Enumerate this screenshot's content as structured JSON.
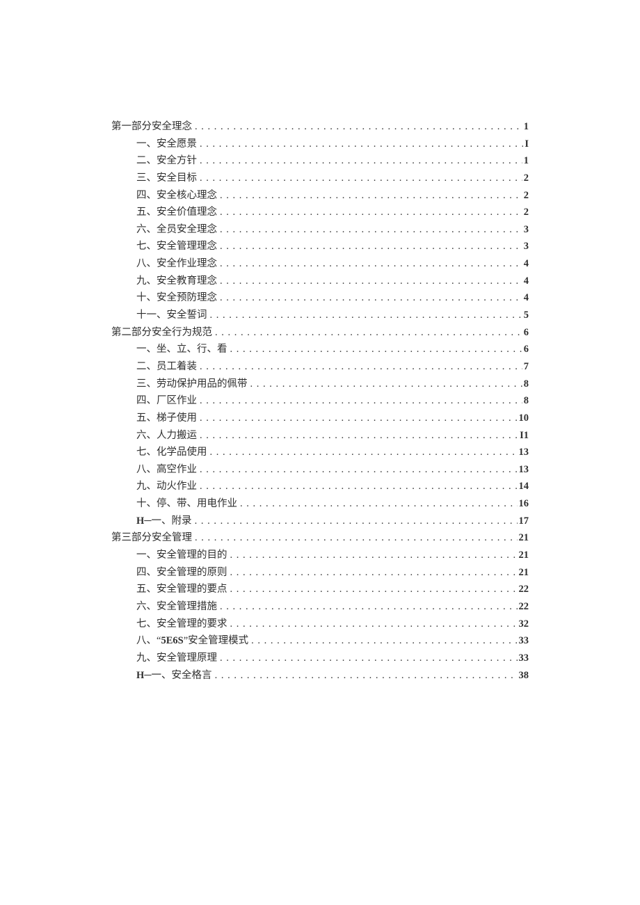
{
  "toc": [
    {
      "level": 0,
      "label": "第一部分安全理念",
      "page": "1"
    },
    {
      "level": 1,
      "label": "一、安全愿景",
      "page": "I"
    },
    {
      "level": 1,
      "label": "二、安全方针",
      "page": "1"
    },
    {
      "level": 1,
      "label": "三、安全目标",
      "page": "2"
    },
    {
      "level": 1,
      "label": "四、安全核心理念",
      "page": "2"
    },
    {
      "level": 1,
      "label": "五、安全价值理念",
      "page": "2"
    },
    {
      "level": 1,
      "label": "六、全员安全理念",
      "page": "3"
    },
    {
      "level": 1,
      "label": "七、安全管理理念",
      "page": "3"
    },
    {
      "level": 1,
      "label": "八、安全作业理念",
      "page": "4"
    },
    {
      "level": 1,
      "label": "九、安全教育理念",
      "page": "4"
    },
    {
      "level": 1,
      "label": "十、安全预防理念",
      "page": "4"
    },
    {
      "level": 1,
      "label": "十一、安全誓词",
      "page": "5"
    },
    {
      "level": 0,
      "label": "第二部分安全行为规范",
      "page": "6"
    },
    {
      "level": 1,
      "label": "一、坐、立、行、看",
      "page": "6"
    },
    {
      "level": 1,
      "label": "二、员工着装",
      "page": "7"
    },
    {
      "level": 1,
      "label": "三、劳动保护用品的佩带",
      "page": "8"
    },
    {
      "level": 1,
      "label": "四、厂区作业",
      "page": "8"
    },
    {
      "level": 1,
      "label": "五、梯子使用",
      "page": "10"
    },
    {
      "level": 1,
      "label": "六、人力搬运",
      "page": "I1"
    },
    {
      "level": 1,
      "label": "七、化学品使用",
      "page": "13"
    },
    {
      "level": 1,
      "label": "八、高空作业",
      "page": "13"
    },
    {
      "level": 1,
      "label": "九、动火作业",
      "page": "14"
    },
    {
      "level": 1,
      "label": "十、停、带、用电作业",
      "page": "16"
    },
    {
      "level": 1,
      "label": "H─一、附录",
      "page": "17",
      "latinPrefix": "H"
    },
    {
      "level": 0,
      "label": "第三部分安全管理",
      "page": "21"
    },
    {
      "level": 1,
      "label": "一、安全管理的目的",
      "page": "21"
    },
    {
      "level": 1,
      "label": "四、安全管理的原则",
      "page": "21"
    },
    {
      "level": 1,
      "label": "五、安全管理的要点",
      "page": "22"
    },
    {
      "level": 1,
      "label": "六、安全管理措施",
      "page": "22"
    },
    {
      "level": 1,
      "label": "七、安全管理的要求",
      "page": "32"
    },
    {
      "level": 1,
      "label": "八、“5E6S”安全管理模式",
      "page": "33",
      "latinInner": "5E6S"
    },
    {
      "level": 1,
      "label": "九、安全管理原理",
      "page": "33"
    },
    {
      "level": 1,
      "label": "H─一、安全格言",
      "page": "38",
      "latinPrefix": "H"
    }
  ]
}
